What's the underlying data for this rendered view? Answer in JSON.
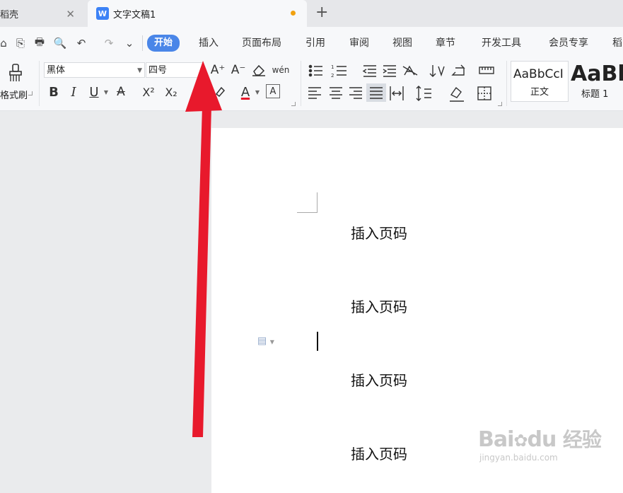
{
  "tabs": [
    {
      "label": "稻壳",
      "close": "✕"
    },
    {
      "label": "文字文稿1",
      "icon": "W"
    }
  ],
  "new_tab": "+",
  "quick_access": [
    "⌂",
    "⎘",
    "🖶",
    "🔍",
    "↶",
    "↷",
    "⌄"
  ],
  "menu": [
    "开始",
    "插入",
    "页面布局",
    "引用",
    "审阅",
    "视图",
    "章节",
    "开发工具",
    "会员专享",
    "稻"
  ],
  "ribbon": {
    "format_painter": "格式刷",
    "font_name": "黑体",
    "font_size": "四号",
    "bold": "B",
    "italic": "I",
    "underline": "U",
    "font_color_a": "A",
    "superscript": "X²",
    "subscript": "X₂",
    "char_border": "A",
    "grow_font": "A⁺",
    "shrink_font": "A⁻",
    "pinyin": "wén",
    "styles": [
      {
        "preview": "AaBbCcI",
        "name": "正文"
      },
      {
        "preview": "AaBb",
        "name": "标题 1"
      }
    ]
  },
  "document": {
    "lines": [
      "插入页码",
      "插入页码",
      "插入页码",
      "插入页码"
    ]
  },
  "watermark": {
    "brand": "Bai",
    "brand2": "du",
    "text": "经验",
    "url": "jingyan.baidu.com"
  },
  "colors": {
    "accent": "#4a86e8",
    "arrow": "#e8192c",
    "modified_dot": "#f1a10f"
  }
}
